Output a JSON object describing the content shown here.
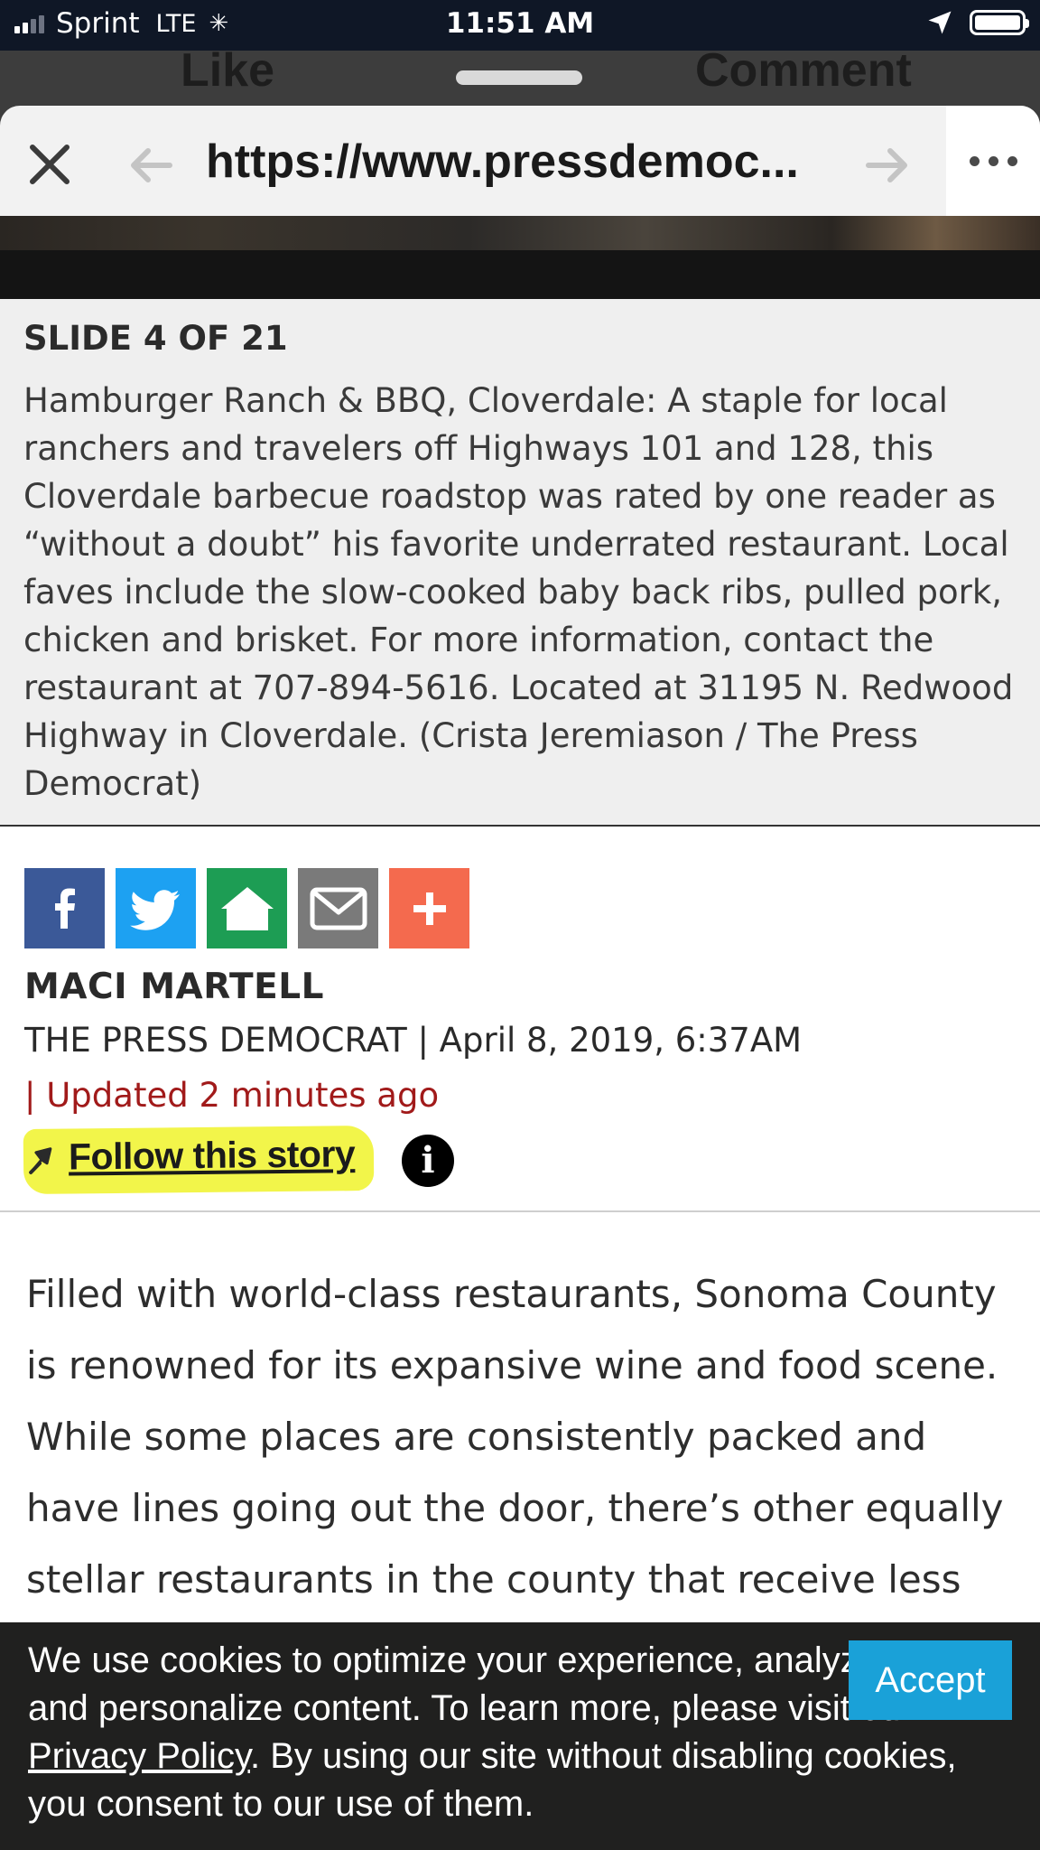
{
  "status_bar": {
    "carrier": "Sprint",
    "network": "LTE",
    "time": "11:51 AM"
  },
  "background_app": {
    "like_label": "Like",
    "comment_label": "Comment"
  },
  "browser": {
    "url": "https://www.pressdemoc..."
  },
  "slide": {
    "counter": "SLIDE 4 OF 21",
    "caption": "Hamburger Ranch & BBQ, Cloverdale: A staple for local ranchers and travelers off Highways 101 and 128, this Cloverdale barbecue roadstop was rated by one reader as “without a doubt” his favorite underrated restaurant. Local faves include the slow-cooked baby back ribs, pulled pork, chicken and brisket. For more information, contact the restaurant at 707-894-5616. Located at 31195 N. Redwood Highway in Cloverdale. (Crista Jeremiason / The Press Democrat)"
  },
  "share": [
    "facebook",
    "twitter",
    "nextdoor",
    "email",
    "more"
  ],
  "article": {
    "author": "MACI MARTELL",
    "byline": "THE PRESS DEMOCRAT | April 8, 2019, 6:37AM",
    "updated": "| Updated 2 minutes ago",
    "follow_label": "Follow this story",
    "info_glyph": "i",
    "body": "Filled with world-class restaurants, Sonoma County is renowned for its expansive wine and food scene. While some places are consistently packed and have lines going out the door, there’s other equally stellar restaurants in the county that receive less attention"
  },
  "cookie": {
    "text_before": "We use cookies to optimize your experience, analyze traffic, and personalize content. To learn more, please visit our ",
    "link": "Privacy Policy",
    "text_after": ". By using our site without disabling cookies, you consent to our use of them.",
    "accept_label": "Accept"
  },
  "colors": {
    "facebook": "#3b5998",
    "twitter": "#1da1f2",
    "nextdoor": "#1d9d54",
    "email": "#7a7a7a",
    "more": "#f46a4e",
    "accept": "#1aa1d8",
    "updated": "#a11a1a",
    "highlight": "#f2f54a"
  }
}
